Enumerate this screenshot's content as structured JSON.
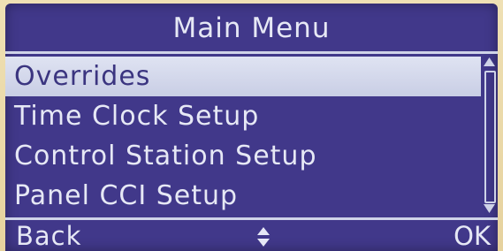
{
  "header": {
    "title": "Main Menu"
  },
  "menu": {
    "items": [
      {
        "label": "Overrides",
        "selected": true
      },
      {
        "label": "Time Clock Setup",
        "selected": false
      },
      {
        "label": "Control Station Setup",
        "selected": false
      },
      {
        "label": "Panel CCI Setup",
        "selected": false
      }
    ]
  },
  "scrollbar": {
    "position_fraction": 0.0,
    "visible_fraction": 0.0
  },
  "softkeys": {
    "left_label": "Back",
    "center_icon": "up-down-arrows-icon",
    "right_label": "OK"
  },
  "colors": {
    "screen_background": "#41388a",
    "text": "#e6e8f5",
    "highlight_background": "#d6daec",
    "highlight_text": "#3b3580"
  }
}
